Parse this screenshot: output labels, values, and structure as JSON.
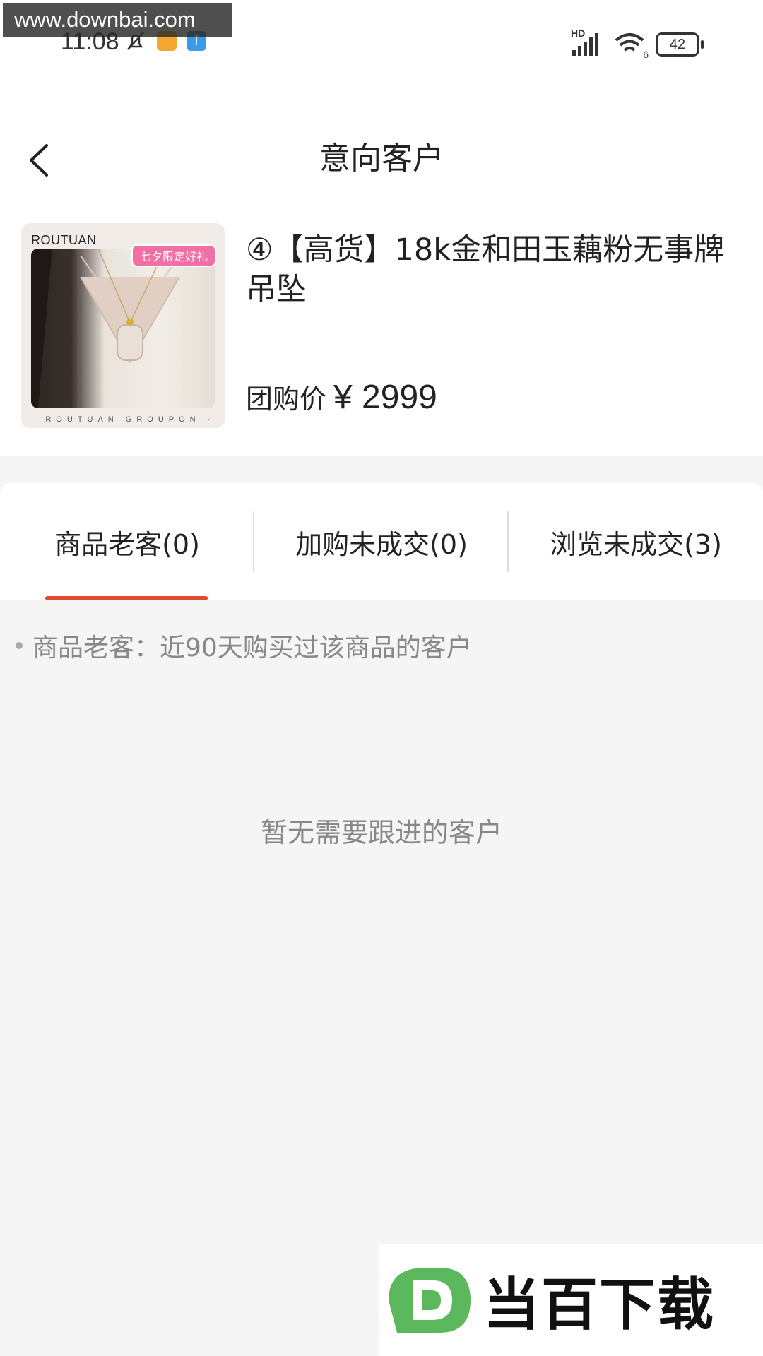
{
  "watermark": {
    "site": "www.downbai.com"
  },
  "status_bar": {
    "time": "11:08",
    "network": "HD",
    "wifi_level": "6",
    "battery": "42"
  },
  "header": {
    "title": "意向客户"
  },
  "product": {
    "title": "④【高货】18k金和田玉藕粉无事牌吊坠",
    "price_label": "团购价",
    "price": "¥ 2999",
    "image": {
      "brand": "ROUTUAN",
      "badge": "七夕限定好礼",
      "footer": "· ROUTUAN GROUPON ·"
    }
  },
  "tabs": [
    {
      "label": "商品老客(0)",
      "active": true
    },
    {
      "label": "加购未成交(0)",
      "active": false
    },
    {
      "label": "浏览未成交(3)",
      "active": false
    }
  ],
  "description": "商品老客：近90天购买过该商品的客户",
  "empty_state": "暂无需要跟进的客户",
  "logo": {
    "text": "当百下载"
  },
  "colors": {
    "accent": "#e24a2f",
    "logo_green": "#5cb85c"
  }
}
